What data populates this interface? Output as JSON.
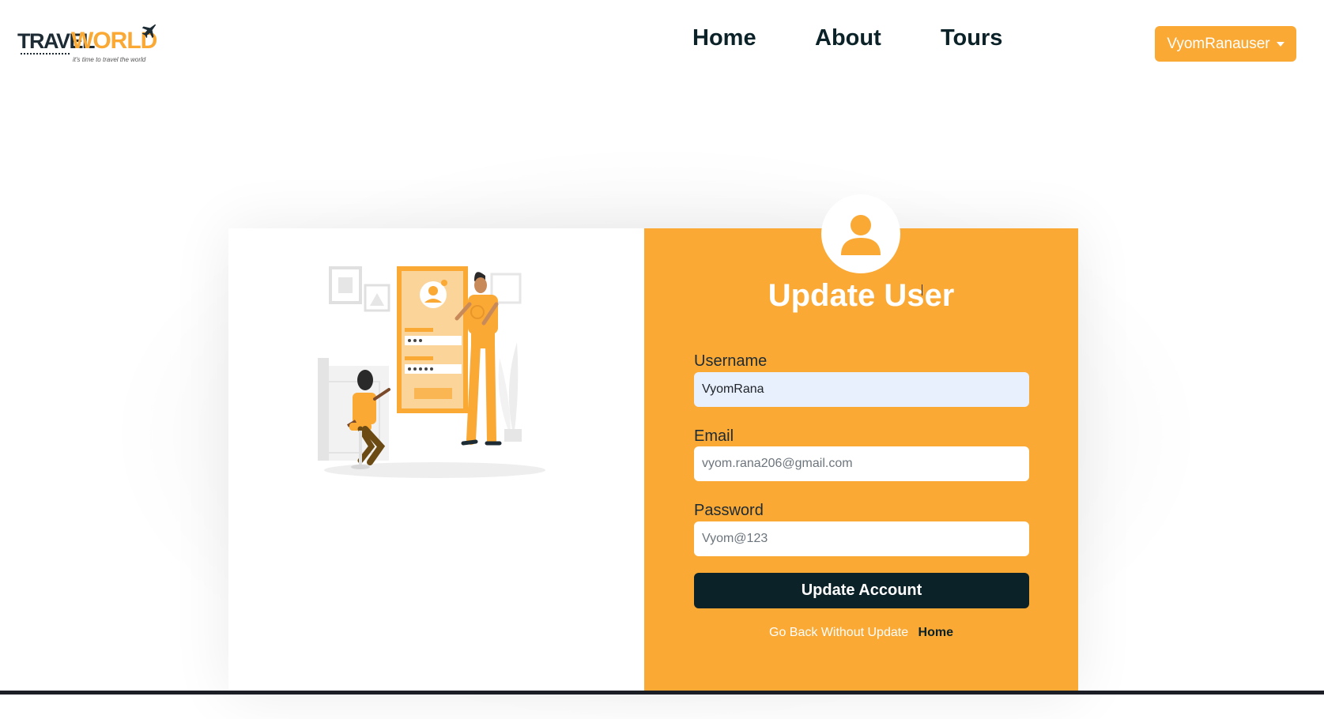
{
  "brand": {
    "word1": "TRAVEL",
    "word2": "WORLD",
    "tagline": "it's time to travel the world"
  },
  "nav": {
    "links": [
      "Home",
      "About",
      "Tours"
    ],
    "user_menu_label": "VyomRanauser"
  },
  "form": {
    "title": "Update User",
    "username": {
      "label": "Username",
      "value": "VyomRana"
    },
    "email": {
      "label": "Email",
      "placeholder": "vyom.rana206@gmail.com"
    },
    "password": {
      "label": "Password",
      "placeholder": "Vyom@123"
    },
    "submit_label": "Update Account",
    "back_text": "Go Back Without Update",
    "back_link": "Home"
  },
  "colors": {
    "accent": "#faa935",
    "dark": "#0b2228",
    "input_filled": "#e8f0fe"
  },
  "icons": [
    "plane-icon",
    "user-avatar-icon",
    "dropdown-caret-icon"
  ]
}
